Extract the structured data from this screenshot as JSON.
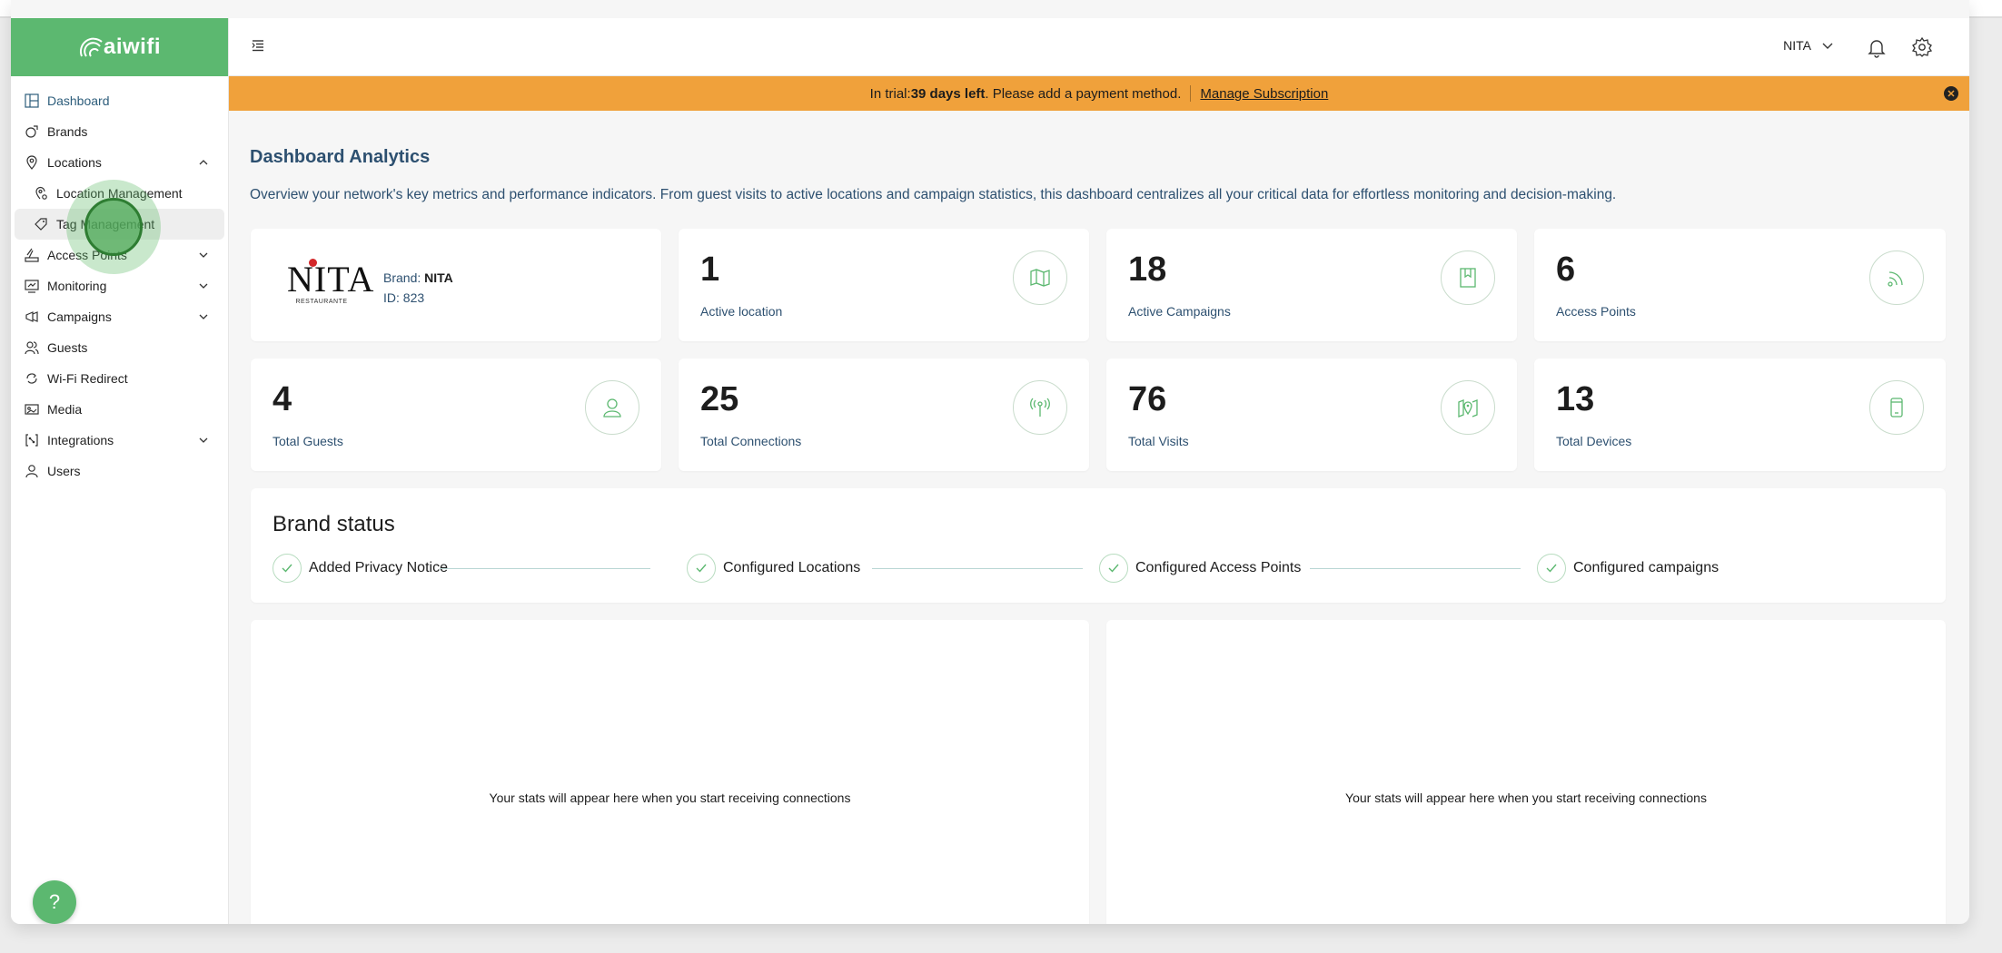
{
  "app": {
    "logo_text": "aiwifi"
  },
  "sidebar": {
    "items": [
      {
        "label": "Dashboard"
      },
      {
        "label": "Brands"
      },
      {
        "label": "Locations"
      },
      {
        "label": "Location Management"
      },
      {
        "label": "Tag Management"
      },
      {
        "label": "Access Points"
      },
      {
        "label": "Monitoring"
      },
      {
        "label": "Campaigns"
      },
      {
        "label": "Guests"
      },
      {
        "label": "Wi-Fi Redirect"
      },
      {
        "label": "Media"
      },
      {
        "label": "Integrations"
      },
      {
        "label": "Users"
      }
    ],
    "help_label": "?"
  },
  "header": {
    "user_name": "NITA"
  },
  "banner": {
    "prefix": "In trial: ",
    "days": "39 days left",
    "suffix": ". Please add a payment method.",
    "link": "Manage Subscription",
    "close": "✕"
  },
  "main": {
    "title": "Dashboard Analytics",
    "description": "Overview your network's key metrics and performance indicators. From guest visits to active locations and campaign statistics, this dashboard centralizes all your critical data for effortless monitoring and decision-making.",
    "brand_card": {
      "logo_name": "NITA",
      "logo_sub": "RESTAURANTE",
      "brand_label": "Brand: ",
      "brand_value": "NITA",
      "id_text": "ID: 823"
    },
    "stats": [
      {
        "value": "1",
        "label": "Active location",
        "icon": "map-icon"
      },
      {
        "value": "18",
        "label": "Active Campaigns",
        "icon": "campaign-book-icon"
      },
      {
        "value": "6",
        "label": "Access Points",
        "icon": "wifi-signal-icon"
      },
      {
        "value": "4",
        "label": "Total Guests",
        "icon": "user-icon"
      },
      {
        "value": "25",
        "label": "Total Connections",
        "icon": "antenna-icon"
      },
      {
        "value": "76",
        "label": "Total Visits",
        "icon": "map-pin-icon"
      },
      {
        "value": "13",
        "label": "Total Devices",
        "icon": "mobile-device-icon"
      }
    ],
    "brand_status": {
      "title": "Brand status",
      "steps": [
        {
          "label": "Added Privacy Notice"
        },
        {
          "label": "Configured Locations"
        },
        {
          "label": "Configured Access Points"
        },
        {
          "label": "Configured campaigns"
        }
      ]
    },
    "empty_message": "Your stats will appear here when you start receiving connections"
  },
  "colors": {
    "brand_green": "#5cb870",
    "banner_orange": "#f0a13b",
    "title_blue": "#2d5070"
  }
}
